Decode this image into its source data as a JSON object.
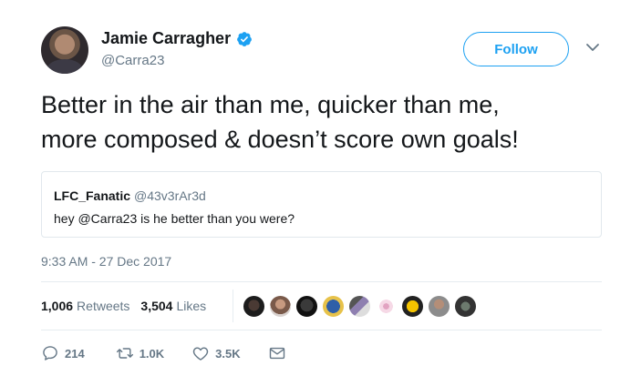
{
  "author": {
    "name": "Jamie Carragher",
    "handle": "@Carra23",
    "verified": true
  },
  "follow_label": "Follow",
  "tweet": {
    "line1": "Better in the air than me, quicker than me,",
    "line2": "more composed & doesn’t score own goals!"
  },
  "quoted": {
    "name": "LFC_Fanatic",
    "handle": "@43v3rAr3d",
    "text": "hey @Carra23 is he better than you were?"
  },
  "timestamp": "9:33 AM - 27 Dec 2017",
  "stats": {
    "retweets_count": "1,006",
    "retweets_label": "Retweets",
    "likes_count": "3,504",
    "likes_label": "Likes"
  },
  "liker_avatars": [
    {
      "name": "liker-avatar-1"
    },
    {
      "name": "liker-avatar-2"
    },
    {
      "name": "liker-avatar-3"
    },
    {
      "name": "liker-avatar-4"
    },
    {
      "name": "liker-avatar-5"
    },
    {
      "name": "liker-avatar-6"
    },
    {
      "name": "liker-avatar-7"
    },
    {
      "name": "liker-avatar-8"
    },
    {
      "name": "liker-avatar-9"
    }
  ],
  "actions": {
    "reply_count": "214",
    "retweet_count": "1.0K",
    "like_count": "3.5K"
  },
  "icons": {
    "verified": "verified-badge-icon",
    "caret": "chevron-down-icon",
    "reply": "reply-icon",
    "retweet": "retweet-icon",
    "like": "heart-icon",
    "dm": "envelope-icon"
  },
  "colors": {
    "accent": "#1da1f2",
    "text": "#14171a",
    "muted": "#657786",
    "border": "#e1e8ed"
  }
}
